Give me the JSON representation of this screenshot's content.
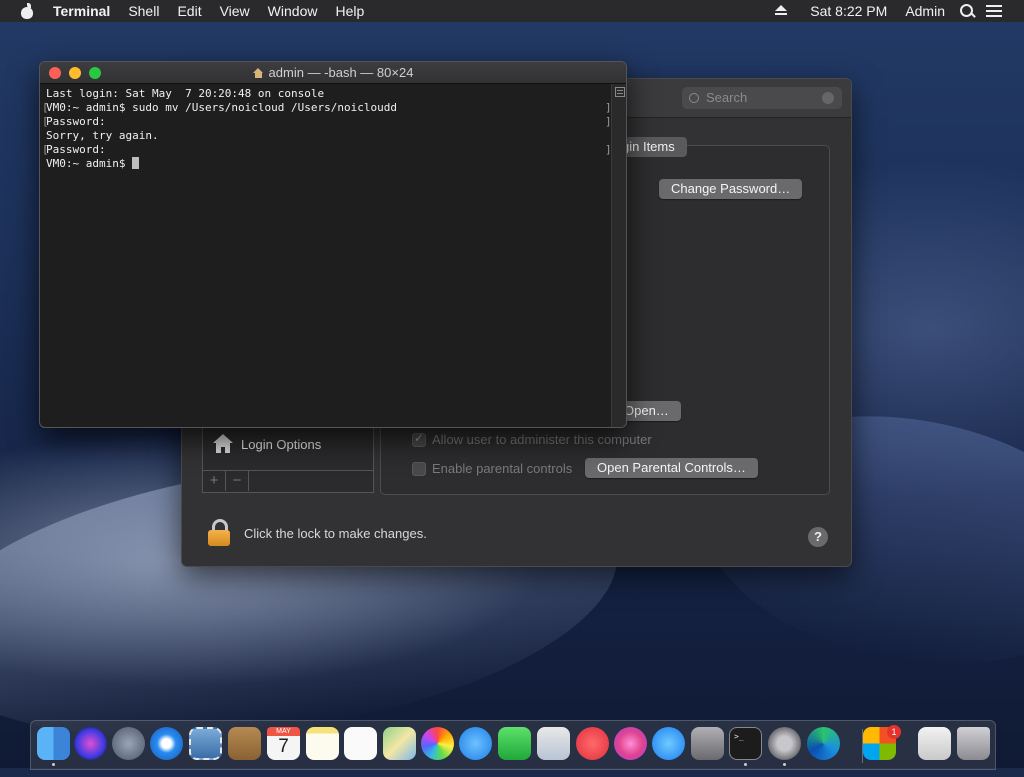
{
  "menubar": {
    "app_name": "Terminal",
    "menus": [
      "Shell",
      "Edit",
      "View",
      "Window",
      "Help"
    ],
    "clock": "Sat 8:22 PM",
    "user": "Admin",
    "icons": [
      "apple-icon",
      "eject-icon",
      "search-icon",
      "list-icon"
    ]
  },
  "terminal": {
    "title": "admin — -bash — 80×24",
    "lines": [
      "Last login: Sat May  7 20:20:48 on console",
      "VM0:~ admin$ sudo mv /Users/noicloud /Users/noicloudd",
      "Password:",
      "Sorry, try again.",
      "Password:",
      "VM0:~ admin$ "
    ]
  },
  "prefs": {
    "search_placeholder": "Search",
    "tab_login_items": "gin Items",
    "change_password": "Change Password…",
    "open_button": "Open…",
    "allow_admin": "Allow user to administer this computer",
    "enable_parental": "Enable parental controls",
    "open_parental": "Open Parental Controls…",
    "login_options": "Login Options",
    "plus": "+",
    "minus": "−",
    "lock_text": "Click the lock to make changes.",
    "help": "?"
  },
  "dock": {
    "calendar_month": "MAY",
    "calendar_day": "7",
    "badge_count": "1",
    "terminal_prompt": ">_",
    "apps": [
      "finder",
      "siri",
      "launchpad",
      "safari",
      "mail-stamp",
      "contacts",
      "calendar",
      "notes",
      "reminders",
      "maps",
      "photos",
      "messages",
      "facetime",
      "preview",
      "news",
      "itunes",
      "app-store",
      "utility",
      "terminal",
      "system-preferences",
      "edge",
      "installer",
      "tool",
      "trash"
    ]
  },
  "colors": {
    "menubar_bg": "#2a2a2c",
    "terminal_bg": "#1e1e1e",
    "prefs_bg": "#323234",
    "close": "#fe5f57",
    "minimize": "#febc2e",
    "zoom": "#28c840"
  }
}
